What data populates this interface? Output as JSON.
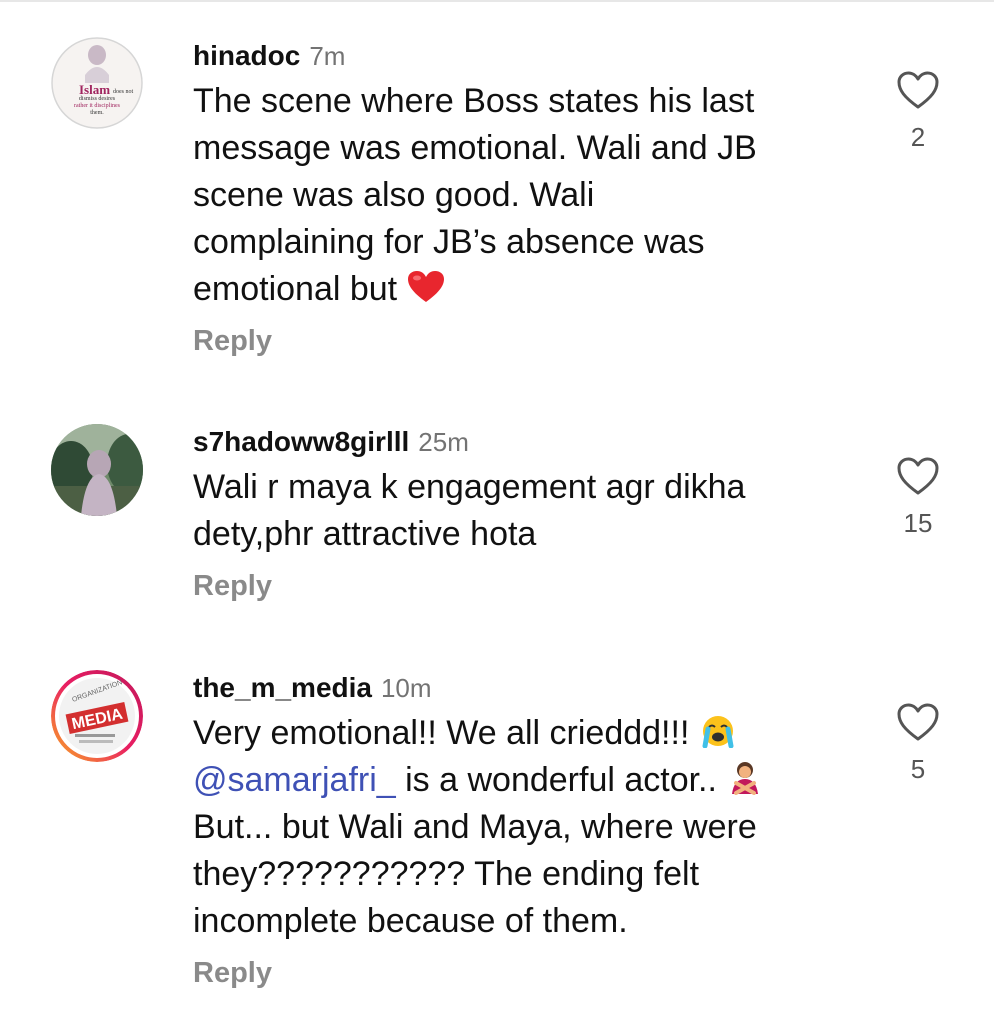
{
  "comments": [
    {
      "username": "hinadoc",
      "time": "7m",
      "lines": [
        "The scene where Boss states his last",
        "message was emotional. Wali and JB",
        "scene was also good. Wali",
        "complaining for JB’s absence was",
        "emotional but"
      ],
      "reply_label": "Reply",
      "likes": "2",
      "avatar_text": [
        "Islam",
        "does not",
        "dismiss desires",
        "rather it disciplines",
        "them."
      ],
      "emoji": "red-heart"
    },
    {
      "username": "s7hadoww8girlll",
      "time": "25m",
      "lines": [
        "Wali r maya k engagement agr dikha",
        "dety,phr attractive hota"
      ],
      "reply_label": "Reply",
      "likes": "15"
    },
    {
      "username": "the_m_media",
      "time": "10m",
      "lines": [
        "Very emotional!! We all crieddd!!!",
        "is a wonderful actor..",
        "But... but Wali and Maya, where were",
        "they??????????? The ending felt",
        "incomplete because of them."
      ],
      "mention": "@samarjafri_",
      "reply_label": "Reply",
      "likes": "5",
      "avatar_text": [
        "MEDIA"
      ]
    }
  ],
  "colors": {
    "background": "#ffffff",
    "username": "#111111",
    "timestamp": "#737373",
    "reply": "#8a8a8a",
    "mention": "#3f51b5"
  },
  "icons": [
    "heart-outline-icon",
    "red-heart-emoji",
    "loudly-crying-face-emoji",
    "person-gesturing-no-emoji"
  ]
}
